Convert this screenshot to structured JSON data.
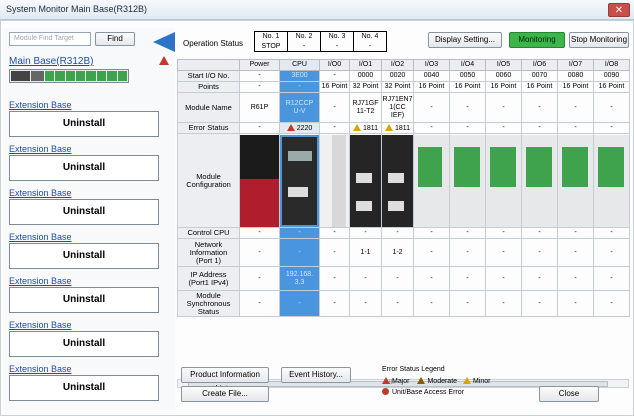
{
  "window": {
    "title": "System Monitor Main Base(R312B)",
    "close_label": "✕"
  },
  "search": {
    "placeholder": "Module Find Target",
    "find_label": "Find"
  },
  "main_base": {
    "label": "Main Base(R312B)"
  },
  "extensions": [
    {
      "link": "Extension Base",
      "status": "Uninstall"
    },
    {
      "link": "Extension Base",
      "status": "Uninstall"
    },
    {
      "link": "Extension Base",
      "status": "Uninstall"
    },
    {
      "link": "Extension Base",
      "status": "Uninstall"
    },
    {
      "link": "Extension Base",
      "status": "Uninstall"
    },
    {
      "link": "Extension Base",
      "status": "Uninstall"
    },
    {
      "link": "Extension Base",
      "status": "Uninstall"
    }
  ],
  "operation_status": {
    "label": "Operation Status",
    "numbers": [
      "No. 1",
      "No. 2",
      "No. 3",
      "No. 4"
    ],
    "values": [
      "STOP",
      "-",
      "-",
      "-"
    ]
  },
  "toolbar": {
    "display_setting": "Display Setting...",
    "monitoring": "Monitoring",
    "stop_monitoring": "Stop Monitoring"
  },
  "grid": {
    "columns": [
      "Power",
      "CPU",
      "I/O0",
      "I/O1",
      "I/O2",
      "I/O3",
      "I/O4",
      "I/O5",
      "I/O6",
      "I/O7",
      "I/O8"
    ],
    "rows": {
      "start_io": {
        "label": "Start I/O No.",
        "values": [
          "-",
          "3E00",
          "-",
          "0000",
          "0020",
          "0040",
          "0050",
          "0060",
          "0070",
          "0080",
          "0090"
        ]
      },
      "points": {
        "label": "Points",
        "values": [
          "-",
          "-",
          "16 Point",
          "32 Point",
          "32 Point",
          "16 Point",
          "16 Point",
          "16 Point",
          "16 Point",
          "16 Point",
          "16 Point"
        ]
      },
      "module_name": {
        "label": "Module Name",
        "values": [
          "R61P",
          "R12CCP\nU-V",
          "-",
          "RJ71GF\n11-T2",
          "RJ71EN7\n1(CC IEF)",
          "-",
          "-",
          "-",
          "-",
          "-",
          "-"
        ]
      },
      "error_status": {
        "label": "Error Status",
        "values": [
          "-",
          "2220",
          "-",
          "1811",
          "1811",
          "-",
          "-",
          "-",
          "-",
          "-",
          "-"
        ]
      },
      "module_config": {
        "label": "Module\nConfiguration"
      },
      "control_cpu": {
        "label": "Control CPU",
        "values": [
          "-",
          "-",
          "-",
          "-",
          "-",
          "-",
          "-",
          "-",
          "-",
          "-",
          "-"
        ]
      },
      "network_info": {
        "label": "Network\nInformation\n(Port 1)",
        "values": [
          "-",
          "-",
          "-",
          "1-1",
          "1-2",
          "-",
          "-",
          "-",
          "-",
          "-",
          "-"
        ]
      },
      "ip_address": {
        "label": "IP Address\n(Port1 IPv4)",
        "values": [
          "-",
          "192.168.\n3.3",
          "-",
          "-",
          "-",
          "-",
          "-",
          "-",
          "-",
          "-",
          "-"
        ]
      },
      "module_sync": {
        "label": "Module\nSynchronous\nStatus",
        "values": [
          "-",
          "-",
          "-",
          "-",
          "-",
          "-",
          "-",
          "-",
          "-",
          "-",
          "-"
        ]
      }
    }
  },
  "scrollbar": {
    "grip": "III"
  },
  "footer": {
    "product_info": "Product Information List...",
    "event_history": "Event History...",
    "create_file": "Create File...",
    "close": "Close"
  },
  "legend": {
    "title": "Error Status Legend",
    "major": "Major",
    "moderate": "Moderate",
    "minor": "Minor",
    "access_error": "Unit/Base Access Error"
  },
  "colors": {
    "accent": "#2d74c8",
    "cpu_column": "#4a96de",
    "monitoring": "#3cb54a",
    "major": "#c0392b",
    "moderate": "#8a5a00",
    "minor": "#d9a300"
  }
}
